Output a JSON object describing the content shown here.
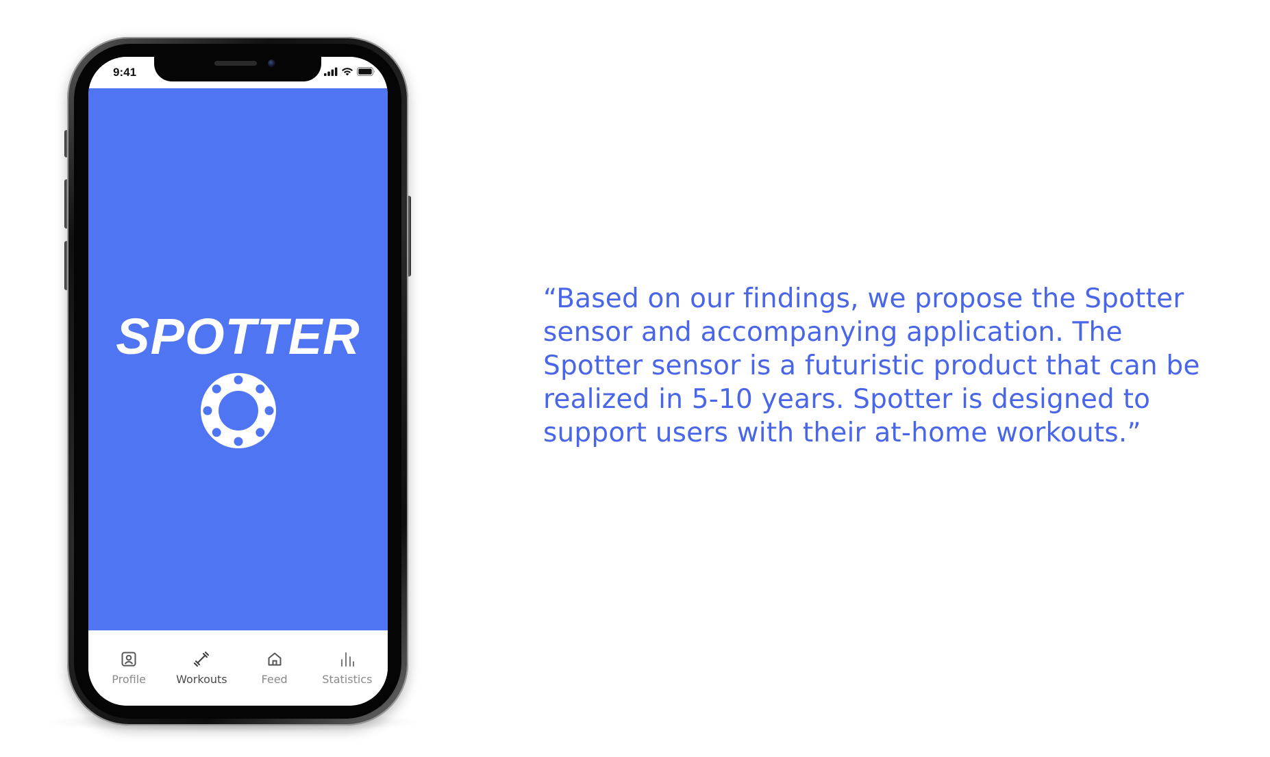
{
  "phone": {
    "status_time": "9:41",
    "app_title": "SPOTTER",
    "logo_icon": "spotter-ring-logo-icon",
    "tabs": [
      {
        "label": "Profile",
        "icon": "profile-icon",
        "active": false
      },
      {
        "label": "Workouts",
        "icon": "dumbbell-icon",
        "active": true
      },
      {
        "label": "Feed",
        "icon": "home-icon",
        "active": false
      },
      {
        "label": "Statistics",
        "icon": "bar-chart-icon",
        "active": false
      }
    ]
  },
  "quote": {
    "lines": [
      "“Based on our findings, we propose the Spotter",
      "sensor and accompanying application. The",
      "Spotter sensor is a futuristic product that can be",
      "realized in 5-10 years. Spotter is designed to",
      "support users with their at-home workouts.”"
    ]
  },
  "colors": {
    "brand_blue": "#5075f3",
    "quote_text": "#4a66e8",
    "background": "#ffffff"
  }
}
